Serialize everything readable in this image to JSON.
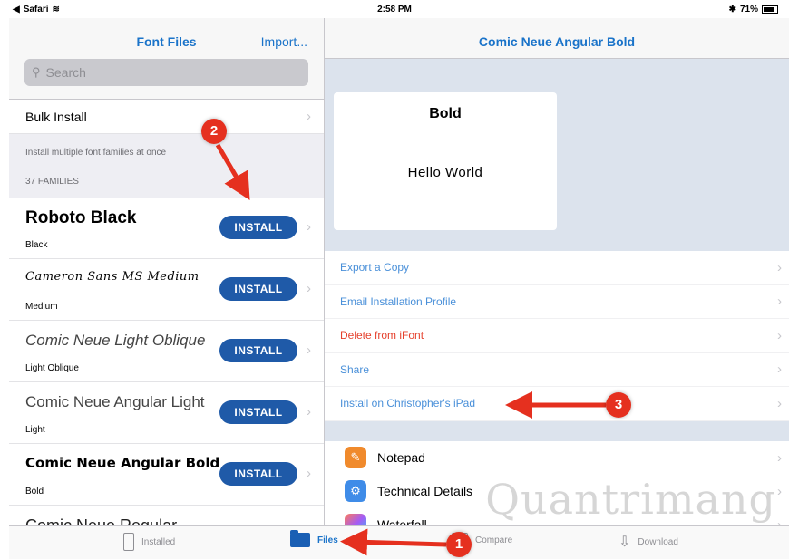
{
  "status_bar": {
    "app": "Safari",
    "time": "2:58 PM",
    "battery": "71%"
  },
  "left": {
    "title": "Font Files",
    "import_label": "Import...",
    "search_placeholder": "Search",
    "bulk_install": "Bulk Install",
    "bulk_desc": "Install multiple font families at once",
    "families_count": "37 FAMILIES",
    "install_label": "INSTALL",
    "fonts": [
      {
        "name": "Roboto Black",
        "style": "Black"
      },
      {
        "name": "Cameron Sans MS Medium",
        "style": "Medium"
      },
      {
        "name": "Comic Neue Light Oblique",
        "style": "Light Oblique"
      },
      {
        "name": "Comic Neue Angular Light",
        "style": "Light"
      },
      {
        "name": "Comic Neue Angular Bold",
        "style": "Bold"
      },
      {
        "name": "Comic Neue Regular",
        "style": ""
      }
    ]
  },
  "right": {
    "title": "Comic Neue Angular Bold",
    "preview_weight": "Bold",
    "preview_text": "Hello World",
    "actions": [
      "Export a Copy",
      "Email Installation Profile",
      "Delete from iFont",
      "Share",
      "Install on Christopher's iPad"
    ],
    "apps": [
      "Notepad",
      "Technical Details",
      "Waterfall"
    ]
  },
  "tabs": [
    "Installed",
    "Files",
    "Compare",
    "Download"
  ],
  "annotations": [
    "1",
    "2",
    "3"
  ],
  "watermark": "Quantrimang",
  "colors": {
    "accent": "#1a73c9",
    "install_button": "#1f5aa8",
    "danger": "#e5412d",
    "annotation": "#e5301f"
  }
}
